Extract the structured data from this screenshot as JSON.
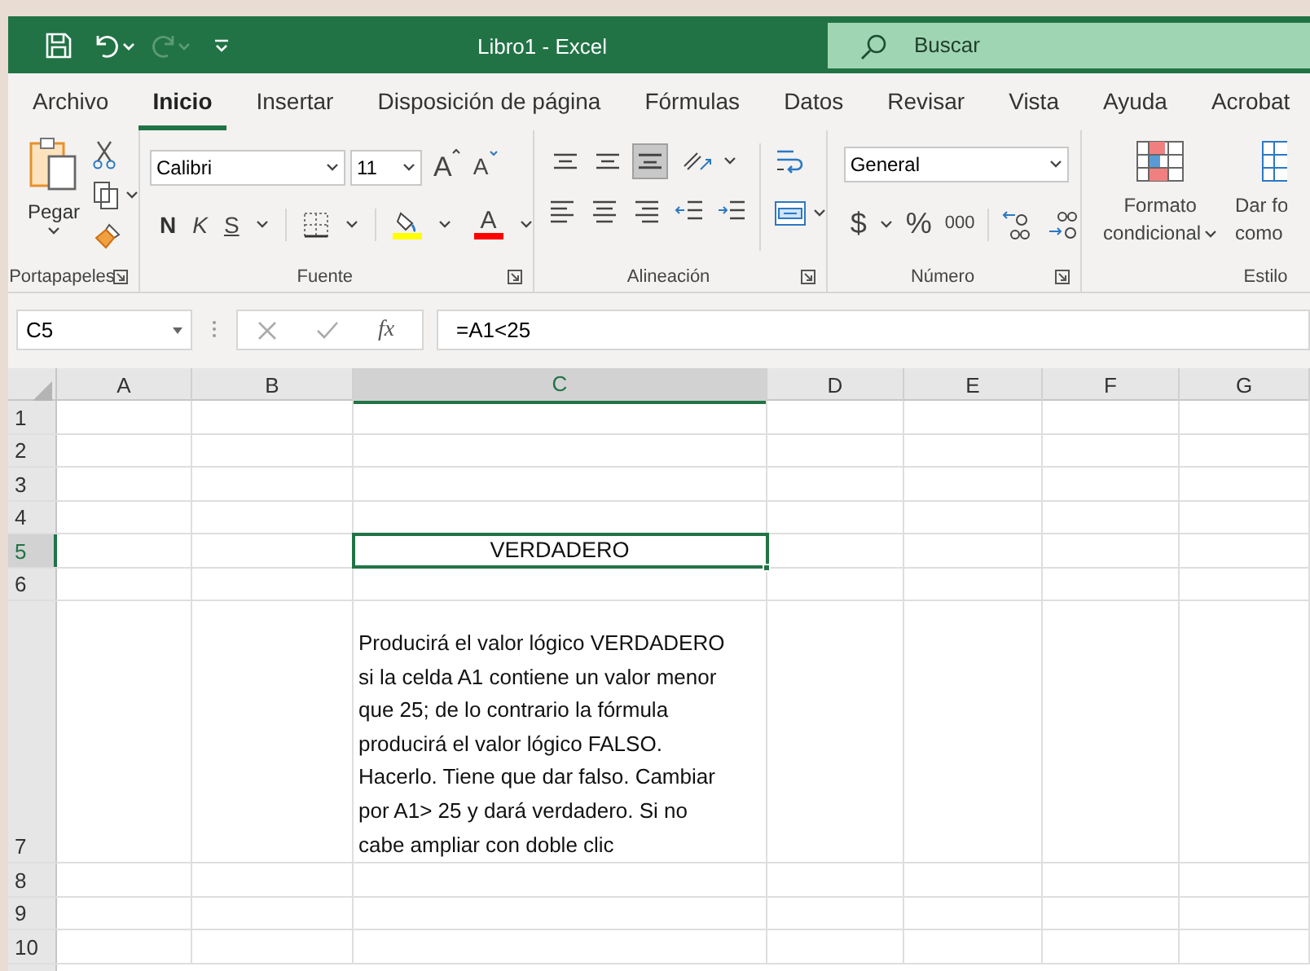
{
  "window": {
    "title": "Libro1  -  Excel"
  },
  "quick_access": {
    "undo_enabled": true,
    "redo_enabled": false
  },
  "search": {
    "placeholder": "Buscar"
  },
  "tabs": [
    {
      "label": "Archivo",
      "selected": false
    },
    {
      "label": "Inicio",
      "selected": true
    },
    {
      "label": "Insertar",
      "selected": false
    },
    {
      "label": "Disposición de página",
      "selected": false
    },
    {
      "label": "Fórmulas",
      "selected": false
    },
    {
      "label": "Datos",
      "selected": false
    },
    {
      "label": "Revisar",
      "selected": false
    },
    {
      "label": "Vista",
      "selected": false
    },
    {
      "label": "Ayuda",
      "selected": false
    },
    {
      "label": "Acrobat",
      "selected": false
    }
  ],
  "ribbon": {
    "clipboard": {
      "paste": "Pegar",
      "label": "Portapapeles"
    },
    "font": {
      "name": "Calibri",
      "size": "11",
      "grow": "A",
      "shrink": "A",
      "bold": "N",
      "italic": "K",
      "underline": "S",
      "font_color": "A",
      "label": "Fuente"
    },
    "alignment": {
      "vertical": [
        {
          "kind": "top",
          "selected": false
        },
        {
          "kind": "middle",
          "selected": false
        },
        {
          "kind": "bottom",
          "selected": true
        }
      ],
      "label": "Alineación"
    },
    "number": {
      "format": "General",
      "currency": "$",
      "percent": "%",
      "thousands": "000",
      "label": "Número"
    },
    "styles": {
      "conditional": [
        "Formato",
        "condicional"
      ],
      "table": [
        "Dar fo",
        "como"
      ],
      "label": "Estilo"
    }
  },
  "formula_bar": {
    "name_box": "C5",
    "fx": "fx",
    "formula": "=A1<25"
  },
  "columns": [
    {
      "label": "A",
      "selected": false
    },
    {
      "label": "B",
      "selected": false
    },
    {
      "label": "C",
      "selected": true
    },
    {
      "label": "D",
      "selected": false
    },
    {
      "label": "E",
      "selected": false
    },
    {
      "label": "F",
      "selected": false
    },
    {
      "label": "G",
      "selected": false
    }
  ],
  "rows": [
    {
      "label": "1",
      "selected": false
    },
    {
      "label": "2",
      "selected": false
    },
    {
      "label": "3",
      "selected": false
    },
    {
      "label": "4",
      "selected": false
    },
    {
      "label": "5",
      "selected": true,
      "cells": [
        {
          "kind": "empty"
        },
        {
          "kind": "empty"
        },
        {
          "text": "VERDADERO",
          "selected": true,
          "kind": "centered"
        }
      ]
    },
    {
      "label": "6",
      "selected": false
    },
    {
      "label": "7",
      "selected": false,
      "cells": [
        {
          "kind": "empty"
        },
        {
          "kind": "empty"
        },
        {
          "text": "Producirá el valor lógico VERDADERO si la celda A1 contiene un valor menor que 25; de lo contrario la fórmula producirá el valor lógico FALSO. Hacerlo. Tiene que dar falso. Cambiar por A1> 25 y dará verdadero. Si no cabe ampliar con doble clic",
          "selected": false,
          "kind": "wrapped"
        }
      ]
    },
    {
      "label": "8",
      "selected": false
    },
    {
      "label": "9",
      "selected": false
    },
    {
      "label": "10",
      "selected": false
    }
  ]
}
